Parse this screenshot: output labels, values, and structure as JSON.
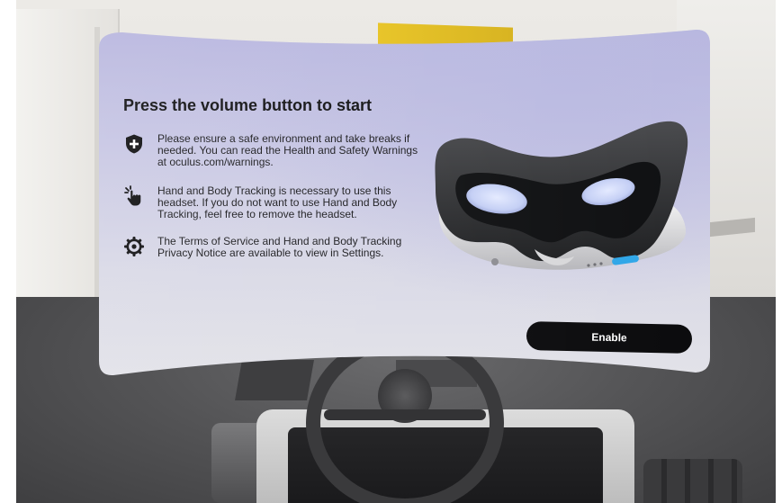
{
  "panel": {
    "title": "Press the volume button to start",
    "items": [
      {
        "icon": "shield-plus-icon",
        "text": "Please ensure a safe environment and take breaks if needed. You can read the Health and Safety Warnings at oculus.com/warnings."
      },
      {
        "icon": "hand-tap-icon",
        "text": "Hand and Body Tracking is necessary to use this headset. If you do not want to use Hand and Body Tracking, feel free to remove the headset."
      },
      {
        "icon": "gear-icon",
        "text": "The Terms of Service and Hand and Body Tracking Privacy Notice are available to view in Settings."
      }
    ],
    "image": "vr-headset-image",
    "enable_label": "Enable"
  },
  "colors": {
    "panel_top": "#b8b6df",
    "panel_bottom": "#e2e2e8",
    "button": "#0b0b0d",
    "button_text": "#ffffff",
    "headset_light": "#2fa6e8"
  }
}
